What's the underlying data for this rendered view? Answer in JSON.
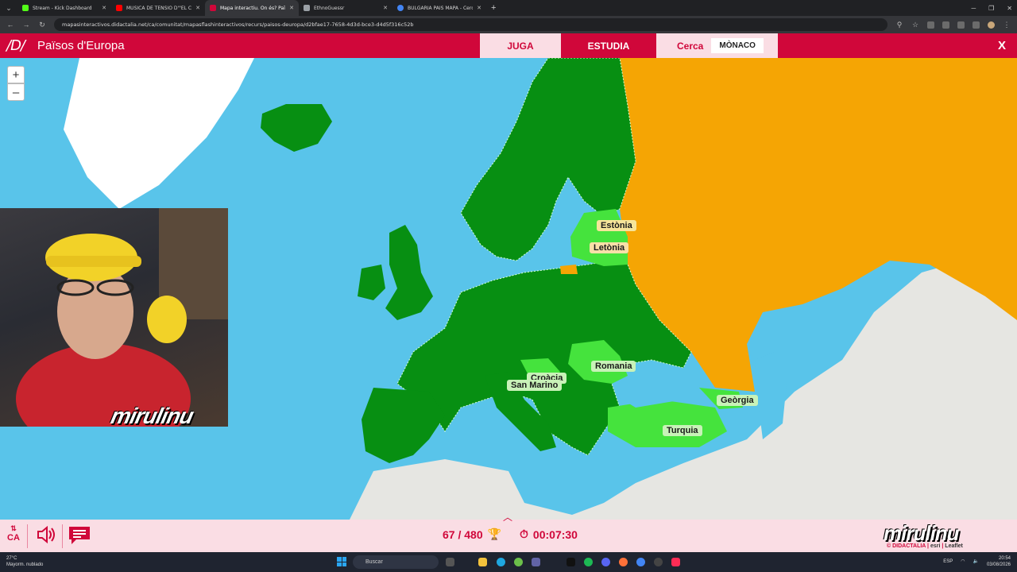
{
  "browser": {
    "tabs": [
      {
        "label": "Stream - Kick Dashboard",
        "color": "#53fc18",
        "active": false
      },
      {
        "label": "MÚSICA DE TENSIÓ D'\"EL C",
        "color": "#ff0000",
        "active": false
      },
      {
        "label": "Mapa interactiu. On és? Països",
        "color": "#d0073a",
        "active": true
      },
      {
        "label": "EthnoGuessr",
        "color": "#9aa0a6",
        "active": false
      },
      {
        "label": "BULGARIA PAIS MAPA - Cerca a",
        "color": "#4285f4",
        "active": false
      }
    ],
    "url": "mapasinteractivos.didactalia.net/ca/comunitat/mapasflashinteractivos/recurs/paisos-deuropa/d2bfae17-7658-4d3d-bce3-d4d5f316c52b"
  },
  "app": {
    "logo": "/D/",
    "title": "Països d'Europa",
    "buttons": {
      "play": "JUGA",
      "study": "ESTUDIA"
    },
    "find": {
      "label": "Cerca",
      "target": "MÒNACO"
    },
    "close": "X"
  },
  "map": {
    "zoom_in": "+",
    "zoom_out": "–",
    "labels": [
      {
        "text": "Estònia",
        "state": "found"
      },
      {
        "text": "Letònia",
        "state": "found"
      },
      {
        "text": "Romania",
        "state": "found"
      },
      {
        "text": "Croàcia",
        "state": "found"
      },
      {
        "text": "San Marino",
        "state": "found"
      },
      {
        "text": "Geòrgia",
        "state": "found"
      },
      {
        "text": "Turquia",
        "state": "found"
      }
    ],
    "colors": {
      "sea": "#59c4ea",
      "land": "#e6e6e2",
      "done": "#078f12",
      "recent": "#45e33d",
      "missed": "#f5a504",
      "ice": "#ffffff"
    }
  },
  "overlay": {
    "streamer": "mirulinu"
  },
  "footer": {
    "language": "CA",
    "score": "67 / 480",
    "timer": "00:07:30",
    "brand": "mirulinu",
    "credit_didactalia": "© DIDACTALIA",
    "credit_esri": "esri",
    "credit_leaflet": "Leaflet"
  },
  "taskbar": {
    "weather_temp": "27°C",
    "weather_desc": "Mayorm. nublado",
    "search": "Buscar",
    "lang": "ESP",
    "time": "20:54",
    "date": "03/08/2026"
  }
}
